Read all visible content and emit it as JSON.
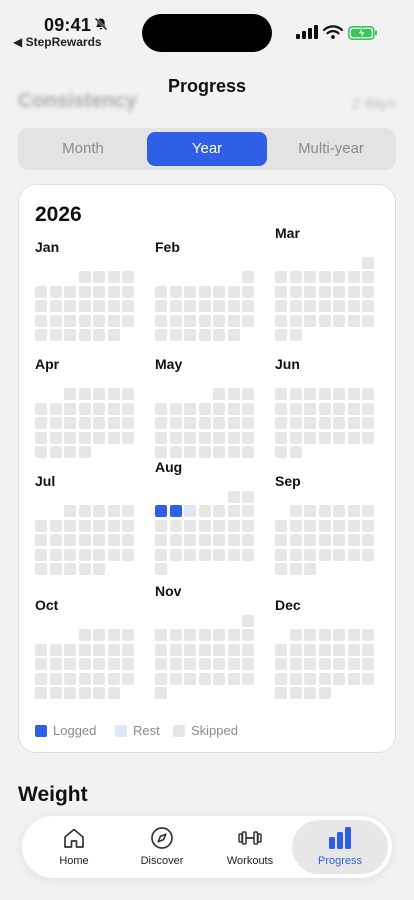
{
  "status": {
    "time": "09:41",
    "back_app": "◀ StepRewards"
  },
  "nav": {
    "title": "Progress"
  },
  "blurred_header": {
    "left": "Consistency",
    "right": "2 days"
  },
  "segments": [
    {
      "label": "Month",
      "selected": false
    },
    {
      "label": "Year",
      "selected": true
    },
    {
      "label": "Multi-year",
      "selected": false
    }
  ],
  "year": "2026",
  "months": [
    {
      "name": "Jan",
      "offset": 3,
      "days": 31
    },
    {
      "name": "Feb",
      "offset": 6,
      "days": 28
    },
    {
      "name": "Mar",
      "offset": 6,
      "days": 31
    },
    {
      "name": "Apr",
      "offset": 2,
      "days": 30
    },
    {
      "name": "May",
      "offset": 4,
      "days": 31
    },
    {
      "name": "Jun",
      "offset": 0,
      "days": 30
    },
    {
      "name": "Jul",
      "offset": 2,
      "days": 31
    },
    {
      "name": "Aug",
      "offset": 5,
      "days": 31
    },
    {
      "name": "Sep",
      "offset": 1,
      "days": 30
    },
    {
      "name": "Oct",
      "offset": 3,
      "days": 31
    },
    {
      "name": "Nov",
      "offset": 6,
      "days": 30
    },
    {
      "name": "Dec",
      "offset": 1,
      "days": 31
    }
  ],
  "activity": {
    "Aug": {
      "logged": [
        3,
        4
      ],
      "rest": [
        5
      ]
    }
  },
  "legend": [
    {
      "label": "Logged",
      "color": "#2f5fe6"
    },
    {
      "label": "Rest",
      "color": "#dde7fb"
    },
    {
      "label": "Skipped",
      "color": "#e6e6e6"
    }
  ],
  "section_title": "Weight",
  "tabs": [
    {
      "label": "Home",
      "icon": "home-icon"
    },
    {
      "label": "Discover",
      "icon": "compass-icon"
    },
    {
      "label": "Workouts",
      "icon": "dumbbell-icon"
    },
    {
      "label": "Progress",
      "icon": "bar-chart-icon",
      "selected": true
    }
  ],
  "colors": {
    "accent": "#2f5fe6",
    "skipped": "#e6e6e6",
    "rest": "#dde7fb"
  }
}
